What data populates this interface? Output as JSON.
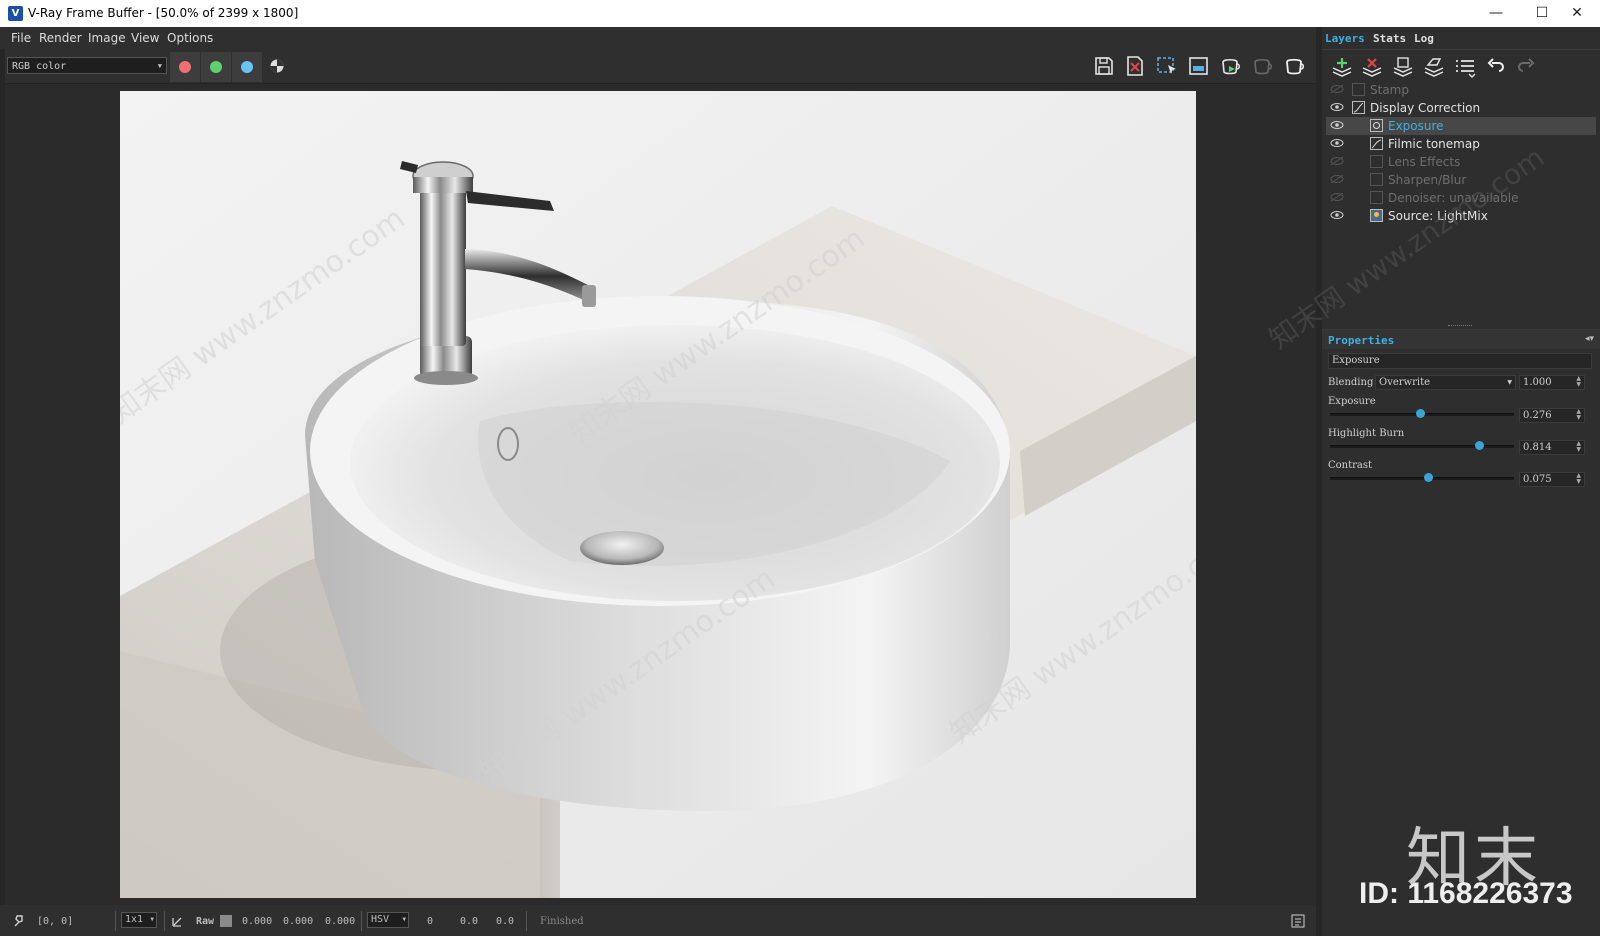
{
  "window": {
    "title": "V-Ray Frame Buffer - [50.0% of 2399 x 1800]",
    "minimize": "—",
    "maximize": "☐",
    "close": "✕"
  },
  "menu": [
    {
      "label": "File"
    },
    {
      "label": "Render"
    },
    {
      "label": "Image"
    },
    {
      "label": "View"
    },
    {
      "label": "Options"
    }
  ],
  "toolbar": {
    "channel": "RGB color",
    "channel_buttons": [
      {
        "icon": "red-channel-icon",
        "color": "#f07070"
      },
      {
        "icon": "green-channel-icon",
        "color": "#5ed06c"
      },
      {
        "icon": "blue-channel-icon",
        "color": "#68c4f2"
      }
    ],
    "right_icons": [
      "save-image-icon",
      "clear-image-icon",
      "region-render-icon",
      "render-last-icon",
      "start-interactive-icon",
      "stop-render-icon",
      "render-icon"
    ]
  },
  "panel": {
    "tabs": [
      {
        "label": "Layers",
        "active": true
      },
      {
        "label": "Stats",
        "active": false
      },
      {
        "label": "Log",
        "active": false
      }
    ],
    "layer_tool_icons": [
      "create-layer-icon",
      "delete-layer-icon",
      "save-layers-icon",
      "load-layers-icon",
      "layer-presets-icon",
      "undo-icon",
      "redo-icon"
    ],
    "layers": [
      {
        "name": "Stamp",
        "enabled": false,
        "indent": 1,
        "selected": false
      },
      {
        "name": "Display Correction",
        "enabled": true,
        "indent": 1,
        "selected": false
      },
      {
        "name": "Exposure",
        "enabled": true,
        "indent": 2,
        "selected": true
      },
      {
        "name": "Filmic tonemap",
        "enabled": true,
        "indent": 2,
        "selected": false
      },
      {
        "name": "Lens Effects",
        "enabled": false,
        "indent": 2,
        "selected": false
      },
      {
        "name": "Sharpen/Blur",
        "enabled": false,
        "indent": 2,
        "selected": false
      },
      {
        "name": "Denoiser: unavailable",
        "enabled": false,
        "indent": 2,
        "selected": false
      },
      {
        "name": "Source: LightMix",
        "enabled": true,
        "indent": 2,
        "selected": false
      }
    ],
    "properties": {
      "title": "Properties",
      "layer_name": "Exposure",
      "blending_label": "Blending",
      "blending_mode": "Overwrite",
      "blending_value": "1.000",
      "params": [
        {
          "label": "Exposure",
          "value": "0.276",
          "fraction": 0.49
        },
        {
          "label": "Highlight Burn",
          "value": "0.814",
          "fraction": 0.81
        },
        {
          "label": "Contrast",
          "value": "0.075",
          "fraction": 0.53
        }
      ]
    }
  },
  "status": {
    "coords": "[0, 0]",
    "zoom": "1x1",
    "raw_label": "Raw",
    "rgb": [
      "0.000",
      "0.000",
      "0.000"
    ],
    "color_mode": "HSV",
    "hsv": [
      "0",
      "0.0",
      "0.0"
    ],
    "state": "Finished"
  },
  "watermark": {
    "site": "www.znzmo.com",
    "brand": "知末网",
    "logo_text": "知末",
    "id": "ID: 1168226373"
  }
}
